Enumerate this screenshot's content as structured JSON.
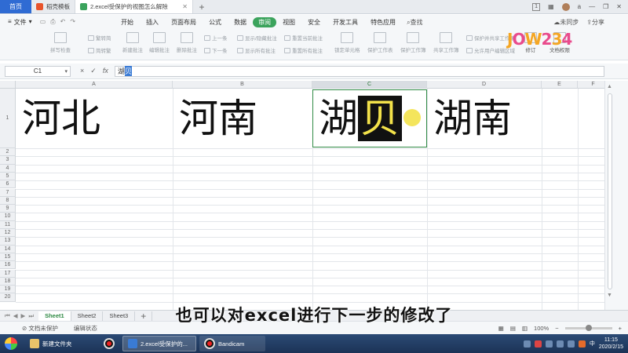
{
  "titlebar": {
    "home_tab": "首页",
    "tabs": [
      {
        "label": "稻壳模板",
        "active": false
      },
      {
        "label": "2.excel受保护的视图怎么解除",
        "active": true
      }
    ],
    "page_badge": "1",
    "user": "a"
  },
  "menubar": {
    "file_label": "文件",
    "tabs": [
      "开始",
      "插入",
      "页面布局",
      "公式",
      "数据",
      "审阅",
      "视图",
      "安全",
      "开发工具",
      "特色应用"
    ],
    "active_tab": "审阅",
    "search_label": "查找",
    "sync_label": "未同步",
    "share_label": "分享"
  },
  "ribbon": {
    "spell_check": "拼写检查",
    "trad_simp": "繁转简",
    "simp_trad": "简转繁",
    "new_comment": "新建批注",
    "edit_comment": "编辑批注",
    "delete_comment": "删除批注",
    "prev_item": "上一条",
    "next_item": "下一条",
    "show_hide_comment": "显示/隐藏批注",
    "show_all_comments": "显示所有批注",
    "reset_current": "重置当前批注",
    "reset_all": "重置所有批注",
    "lock_cell": "锁定单元格",
    "protect_sheet": "保护工作表",
    "protect_workbook": "保护工作簿",
    "share_workbook": "共享工作簿",
    "protect_share": "保护并共享工作簿",
    "allow_edit": "允许用户编辑区域",
    "track_changes": "修订",
    "doc_permissions": "文档权限",
    "logo_text": "JOW234"
  },
  "formula": {
    "name_box": "C1",
    "cancel_icon": "×",
    "confirm_icon": "✓",
    "fx_label": "fx",
    "content_plain": "湖",
    "content_selected": "贝"
  },
  "grid": {
    "columns": [
      "A",
      "B",
      "C",
      "D",
      "E",
      "F"
    ],
    "selected_column": "C",
    "rows": [
      "1",
      "2",
      "3",
      "4",
      "5",
      "6",
      "7",
      "8",
      "9",
      "10",
      "11",
      "12",
      "13",
      "14",
      "15",
      "16",
      "17",
      "18",
      "19",
      "20"
    ],
    "cells": {
      "A1": "河北",
      "B1": "河南",
      "C1_plain": "湖",
      "C1_highlight": "贝",
      "D1": "湖南"
    }
  },
  "sheets": {
    "tabs": [
      "Sheet1",
      "Sheet2",
      "Sheet3"
    ],
    "active": "Sheet1",
    "add_label": "+"
  },
  "status": {
    "protect_status": "文档未保护",
    "edit_status": "编辑状态",
    "zoom": "100%"
  },
  "subtitle": "也可以对excel进行下一步的修改了",
  "taskbar": {
    "items": [
      {
        "label": "新建文件夹"
      },
      {
        "label": "2.excel受保护的..."
      },
      {
        "label": "Bandicam"
      }
    ],
    "time": "11:15",
    "date": "2020/2/15",
    "lang": "中"
  }
}
